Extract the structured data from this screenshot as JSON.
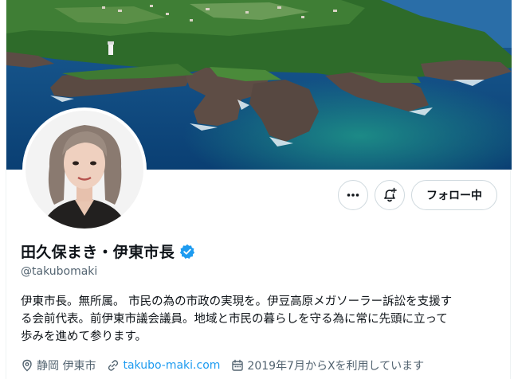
{
  "profile": {
    "display_name": "田久保まき・伊東市長",
    "handle": "@takubomaki",
    "verified": true,
    "bio_lines": [
      "伊東市長。無所属。 市民の為の市政の実現を。伊豆高原メガソーラー訴訟を支援す",
      "る会前代表。前伊東市議会議員。地域と市民の暮らしを守る為に常に先頭に立って",
      "歩みを進めて参ります。"
    ],
    "location": "静岡 伊東市",
    "website": "takubo-maki.com",
    "joined": "2019年7月からXを利用しています"
  },
  "actions": {
    "more_icon": "more-icon",
    "notify_icon": "bell-plus-icon",
    "follow_label": "フォロー中"
  },
  "colors": {
    "accent": "#1d9bf0",
    "text": "#0f1419",
    "muted": "#536471",
    "border": "#cfd9de"
  }
}
